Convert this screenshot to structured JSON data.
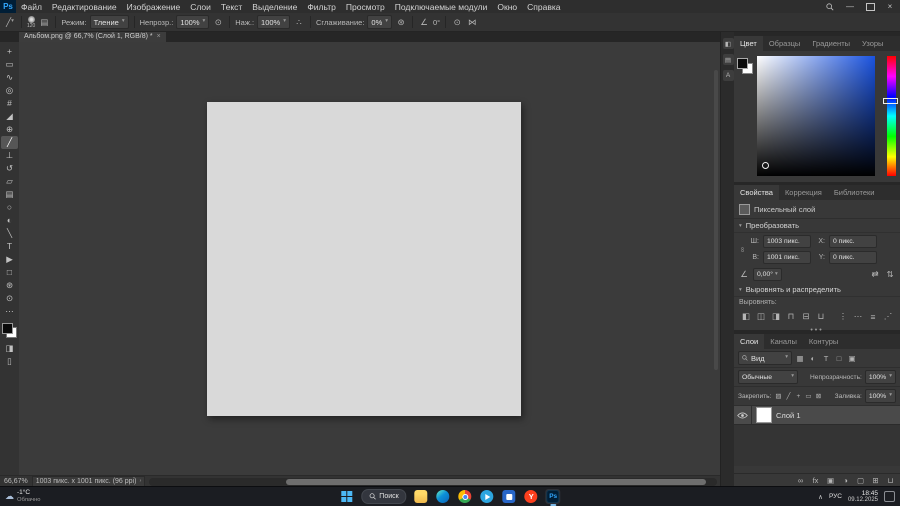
{
  "glyphs": {
    "caret": "▾",
    "section": "▾",
    "close": "×",
    "minimize": "—",
    "chain": "∞",
    "angle_icon": "∠",
    "flip_h": "⇄",
    "flip_v": "⇅",
    "more": "•••",
    "pressure": "⊙",
    "airbrush": "∴",
    "gear": "⊛",
    "symmetry": "⋈",
    "cloud": "☁",
    "tray_chevron": "∧",
    "info_caret": "›"
  },
  "menubar": {
    "logo": "Ps",
    "items": [
      "Файл",
      "Редактирование",
      "Изображение",
      "Слои",
      "Текст",
      "Выделение",
      "Фильтр",
      "Просмотр",
      "Подключаемые модули",
      "Окно",
      "Справка"
    ]
  },
  "optionsbar": {
    "tool_preset_glyph": "╱",
    "brush_size": "120",
    "brush_panel_glyph": "▤",
    "mode_label": "Режим:",
    "mode_value": "Тление",
    "opacity_label": "Непрозр.:",
    "opacity_value": "100%",
    "flow_label": "Наж.:",
    "flow_value": "100%",
    "smoothing_label": "Сглаживание:",
    "smoothing_value": "0%",
    "angle_value": "0°"
  },
  "document_tab": {
    "title": "Альбом.png @ 66,7% (Слой 1, RGB/8) *"
  },
  "toolbar": {
    "tools_top": [
      {
        "name": "move",
        "glyph": "+"
      },
      {
        "name": "marquee",
        "glyph": "▭"
      },
      {
        "name": "lasso",
        "glyph": "∿"
      },
      {
        "name": "object-selection",
        "glyph": "◎"
      },
      {
        "name": "crop",
        "glyph": "#"
      },
      {
        "name": "eyedropper",
        "glyph": "◢"
      },
      {
        "name": "healing-brush",
        "glyph": "⊕"
      },
      {
        "name": "brush",
        "glyph": "╱",
        "selected": true
      },
      {
        "name": "clone-stamp",
        "glyph": "⊥"
      },
      {
        "name": "history-brush",
        "glyph": "↺"
      },
      {
        "name": "eraser",
        "glyph": "▱"
      },
      {
        "name": "gradient",
        "glyph": "▤"
      },
      {
        "name": "blur",
        "glyph": "○"
      },
      {
        "name": "dodge",
        "glyph": "◐"
      },
      {
        "name": "pen",
        "glyph": "╲"
      },
      {
        "name": "type",
        "glyph": "T"
      },
      {
        "name": "path-selection",
        "glyph": "▶"
      },
      {
        "name": "shape",
        "glyph": "□"
      },
      {
        "name": "hand",
        "glyph": "⊛"
      },
      {
        "name": "zoom",
        "glyph": "⊙"
      },
      {
        "name": "edit-toolbar",
        "glyph": "⋯"
      }
    ],
    "tools_bottom": [
      {
        "name": "quick-mask",
        "glyph": "◨"
      },
      {
        "name": "screen-mode",
        "glyph": "▯"
      }
    ]
  },
  "collapsed_panels": [
    {
      "name": "collapsed-panel-1",
      "glyph": "◧"
    },
    {
      "name": "collapsed-panel-2",
      "glyph": "▤"
    },
    {
      "name": "collapsed-panel-character",
      "glyph": "A"
    }
  ],
  "color_panel": {
    "tabs": [
      {
        "label": "Цвет",
        "active": true
      },
      {
        "label": "Образцы"
      },
      {
        "label": "Градиенты"
      },
      {
        "label": "Узоры"
      }
    ]
  },
  "properties_panel": {
    "tabs": [
      {
        "label": "Свойства",
        "active": true
      },
      {
        "label": "Коррекция"
      },
      {
        "label": "Библиотеки"
      }
    ],
    "layer_type": "Пиксельный слой",
    "transform_title": "Преобразовать",
    "w_label": "Ш:",
    "w": "1003 пикс.",
    "h_label": "В:",
    "h": "1001 пикс.",
    "x_label": "X:",
    "x": "0 пикс.",
    "y_label": "Y:",
    "y": "0 пикс.",
    "angle": "0,00°",
    "align_title": "Выровнять и распределить",
    "align_label": "Выровнять:",
    "align_icons": [
      {
        "name": "align-left",
        "glyph": "◧"
      },
      {
        "name": "align-center-h",
        "glyph": "◫"
      },
      {
        "name": "align-right",
        "glyph": "◨"
      },
      {
        "name": "align-top",
        "glyph": "⊓"
      },
      {
        "name": "align-center-v",
        "glyph": "⊟"
      },
      {
        "name": "align-bottom",
        "glyph": "⊔"
      }
    ],
    "distribute_icons": [
      {
        "name": "distribute-1",
        "glyph": "⋮"
      },
      {
        "name": "distribute-2",
        "glyph": "⋯"
      },
      {
        "name": "distribute-3",
        "glyph": "≡"
      },
      {
        "name": "distribute-4",
        "glyph": "⋰"
      }
    ]
  },
  "layers_panel": {
    "tabs": [
      {
        "label": "Слои",
        "active": true
      },
      {
        "label": "Каналы"
      },
      {
        "label": "Контуры"
      }
    ],
    "filter_label": "Вид",
    "filter_icons": [
      {
        "name": "filter-pixel-layers",
        "glyph": "▦"
      },
      {
        "name": "filter-adjustment-layers",
        "glyph": "◐"
      },
      {
        "name": "filter-type-layers",
        "glyph": "T"
      },
      {
        "name": "filter-shape-layers",
        "glyph": "□"
      },
      {
        "name": "filter-smart-objects",
        "glyph": "▣"
      }
    ],
    "blend_mode": "Обычные",
    "opacity_label": "Непрозрачность:",
    "opacity_value": "100%",
    "lock_label": "Закрепить:",
    "lock_icons": [
      {
        "name": "lock-transparency",
        "glyph": "▨"
      },
      {
        "name": "lock-paint",
        "glyph": "╱"
      },
      {
        "name": "lock-position",
        "glyph": "+"
      },
      {
        "name": "lock-artboard",
        "glyph": "▭"
      },
      {
        "name": "lock-all",
        "glyph": "⊠"
      }
    ],
    "fill_label": "Заливка:",
    "fill_value": "100%",
    "layers": [
      {
        "name": "Слой 1"
      }
    ],
    "footer_icons": [
      {
        "name": "link-layers",
        "glyph": "∞"
      },
      {
        "name": "layer-effects",
        "glyph": "fx"
      },
      {
        "name": "layer-mask",
        "glyph": "▣"
      },
      {
        "name": "adjustment-layer",
        "glyph": "◑"
      },
      {
        "name": "layer-group",
        "glyph": "▢"
      },
      {
        "name": "new-layer",
        "glyph": "⊞"
      },
      {
        "name": "delete-layer",
        "glyph": "⊔"
      }
    ]
  },
  "statusbar": {
    "zoom": "66,67%",
    "doc_info": "1003 пикс. x 1001 пикс. (96 ppi)"
  },
  "taskbar": {
    "weather_temp": "-1°C",
    "weather_desc": "Облачно",
    "search_label": "Поиск",
    "yandex_letter": "Y",
    "ps_label": "Ps",
    "lang": "РУС",
    "time": "18:45",
    "date": "09.12.2025"
  }
}
